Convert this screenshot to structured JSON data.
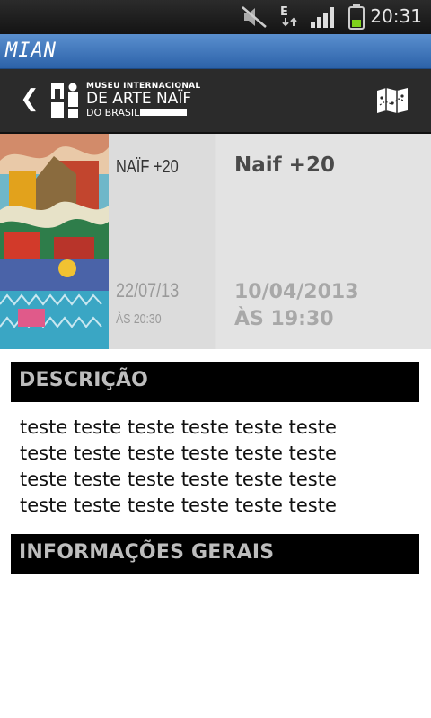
{
  "status_bar": {
    "time": "20:31",
    "icons": [
      "mute-icon",
      "data-e-icon",
      "signal-icon",
      "battery-icon"
    ]
  },
  "app": {
    "title": "MIAN"
  },
  "header": {
    "logo": {
      "line1": "MUSEU INTERNACIONAL",
      "line2": "DE ARTE NAÏF",
      "line3": "DO BRASIL"
    }
  },
  "event": {
    "thumb_title": "NAÏF +20",
    "thumb_date": "22/07/13",
    "thumb_time": "ÀS 20:30",
    "title": "Naif +20",
    "date": "10/04/2013",
    "time": "ÀS 19:30"
  },
  "sections": {
    "description_header": "DESCRIÇÃO",
    "description_lines": [
      "teste teste teste teste teste teste",
      "teste teste teste teste teste teste",
      "teste teste teste teste teste teste",
      "teste teste teste teste teste teste"
    ],
    "info_header": "INFORMAÇÕES GERAIS"
  }
}
